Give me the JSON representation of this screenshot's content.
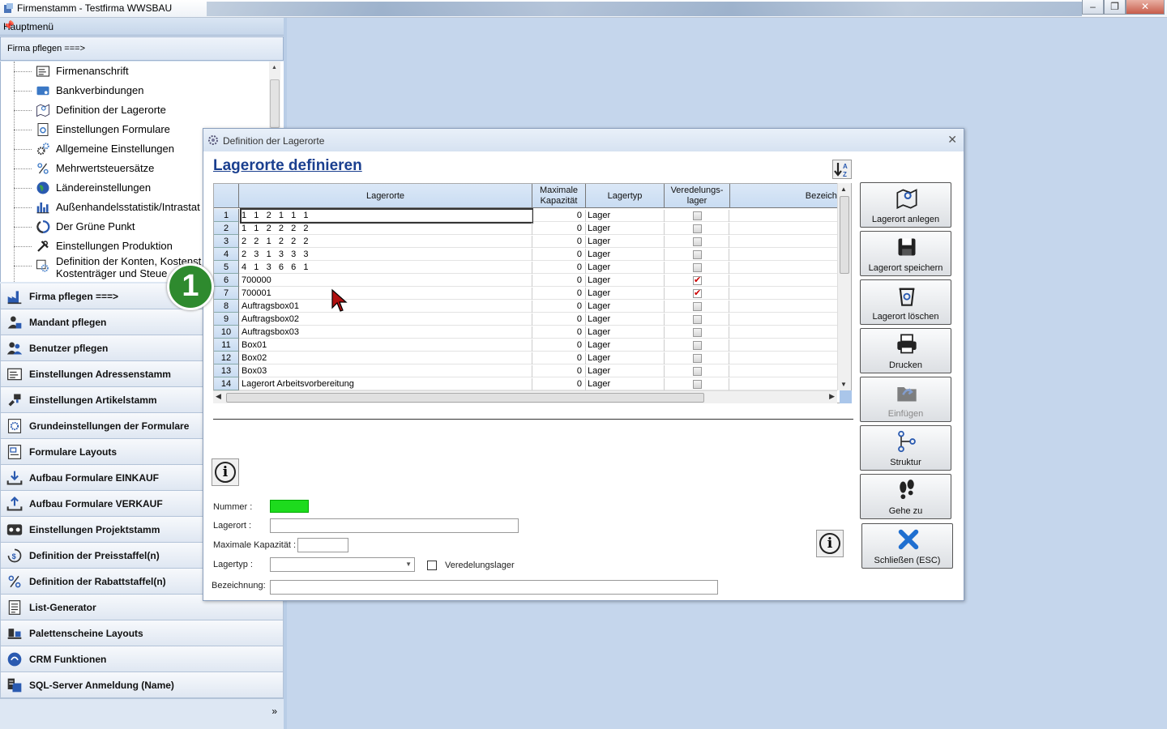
{
  "window": {
    "title": "Firmenstamm - Testfirma WWSBAU"
  },
  "left_panel": {
    "header": "Hauptmenü",
    "current_section": "Firma pflegen   ===>",
    "tree_items": [
      {
        "label": "Firmenanschrift",
        "icon": "address-card-icon"
      },
      {
        "label": "Bankverbindungen",
        "icon": "bank-card-icon"
      },
      {
        "label": "Definition der Lagerorte",
        "icon": "map-pin-icon"
      },
      {
        "label": "Einstellungen Formulare",
        "icon": "form-settings-icon"
      },
      {
        "label": "Allgemeine Einstellungen",
        "icon": "gears-icon"
      },
      {
        "label": "Mehrwertsteuersätze",
        "icon": "percent-icon"
      },
      {
        "label": "Ländereinstellungen",
        "icon": "globe-icon"
      },
      {
        "label": "Außenhandelsstatistik/Intrastat",
        "icon": "bar-chart-icon"
      },
      {
        "label": "Der Grüne Punkt",
        "icon": "recycle-icon"
      },
      {
        "label": "Einstellungen Produktion",
        "icon": "tools-icon"
      },
      {
        "label": "Definition der Konten, Kostenst",
        "label2": "Kostenträger und Steue",
        "icon": "accounts-gear-icon"
      }
    ],
    "nav_items": [
      {
        "label": "Firma pflegen   ===>",
        "icon": "factory-icon"
      },
      {
        "label": "Mandant pflegen",
        "icon": "client-icon"
      },
      {
        "label": "Benutzer pflegen",
        "icon": "users-icon"
      },
      {
        "label": "Einstellungen Adressenstamm",
        "icon": "address-icon"
      },
      {
        "label": "Einstellungen Artikelstamm",
        "icon": "article-icon"
      },
      {
        "label": "Grundeinstellungen der Formulare",
        "icon": "form-gear-icon"
      },
      {
        "label": "Formulare Layouts",
        "icon": "layout-icon"
      },
      {
        "label": "Aufbau Formulare EINKAUF",
        "icon": "download-tray-icon"
      },
      {
        "label": "Aufbau Formulare VERKAUF",
        "icon": "upload-tray-icon"
      },
      {
        "label": "Einstellungen Projektstamm",
        "icon": "project-icon"
      },
      {
        "label": "Definition der Preisstaffel(n)",
        "icon": "price-icon"
      },
      {
        "label": "Definition der Rabattstaffel(n)",
        "icon": "discount-icon"
      },
      {
        "label": "List-Generator",
        "icon": "list-icon"
      },
      {
        "label": "Palettenscheine Layouts",
        "icon": "pallet-icon"
      },
      {
        "label": "CRM Funktionen",
        "icon": "crm-icon"
      },
      {
        "label": "SQL-Server Anmeldung (Name)",
        "icon": "server-icon"
      }
    ],
    "more_glyph": "»"
  },
  "badge": "1",
  "dialog": {
    "title": "Definition der Lagerorte",
    "heading": "Lagerorte definieren",
    "columns": {
      "lagerorte": "Lagerorte",
      "kapazitaet_1": "Maximale",
      "kapazitaet_2": "Kapazität",
      "lagertyp": "Lagertyp",
      "veredelung_1": "Veredelungs-",
      "veredelung_2": "lager",
      "bezeichnung": "Bezeichn"
    },
    "rows": [
      {
        "nr": "1",
        "lagerort": "1   1   2   1   1   1",
        "kap": "0",
        "typ": "Lager",
        "ver": false
      },
      {
        "nr": "2",
        "lagerort": "1   1   2   2   2   2",
        "kap": "0",
        "typ": "Lager",
        "ver": false
      },
      {
        "nr": "3",
        "lagerort": "2   2   1   2   2   2",
        "kap": "0",
        "typ": "Lager",
        "ver": false
      },
      {
        "nr": "4",
        "lagerort": "2   3   1   3   3   3",
        "kap": "0",
        "typ": "Lager",
        "ver": false
      },
      {
        "nr": "5",
        "lagerort": "4   1   3   6   6   1",
        "kap": "0",
        "typ": "Lager",
        "ver": false
      },
      {
        "nr": "6",
        "lagerort": "700000",
        "kap": "0",
        "typ": "Lager",
        "ver": true
      },
      {
        "nr": "7",
        "lagerort": "700001",
        "kap": "0",
        "typ": "Lager",
        "ver": true
      },
      {
        "nr": "8",
        "lagerort": "Auftragsbox01",
        "kap": "0",
        "typ": "Lager",
        "ver": false
      },
      {
        "nr": "9",
        "lagerort": "Auftragsbox02",
        "kap": "0",
        "typ": "Lager",
        "ver": false
      },
      {
        "nr": "10",
        "lagerort": "Auftragsbox03",
        "kap": "0",
        "typ": "Lager",
        "ver": false
      },
      {
        "nr": "11",
        "lagerort": "Box01",
        "kap": "0",
        "typ": "Lager",
        "ver": false
      },
      {
        "nr": "12",
        "lagerort": "Box02",
        "kap": "0",
        "typ": "Lager",
        "ver": false
      },
      {
        "nr": "13",
        "lagerort": "Box03",
        "kap": "0",
        "typ": "Lager",
        "ver": false
      },
      {
        "nr": "14",
        "lagerort": "Lagerort Arbeitsvorbereitung",
        "kap": "0",
        "typ": "Lager",
        "ver": false
      }
    ],
    "form": {
      "nummer_label": "Nummer :",
      "lagerort_label": "Lagerort :",
      "kapazitaet_label": "Maximale Kapazität :",
      "lagertyp_label": "Lagertyp :",
      "veredelung_label": "Veredelungslager",
      "bezeichnung_label": "Bezeichnung:",
      "nummer_value": "",
      "lagerort_value": "",
      "kapazitaet_value": "",
      "lagertyp_value": "",
      "bezeichnung_value": ""
    },
    "buttons": [
      {
        "label": "Lagerort anlegen",
        "icon": "map-add-icon",
        "enabled": true
      },
      {
        "label": "Lagerort speichern",
        "icon": "save-icon",
        "enabled": true
      },
      {
        "label": "Lagerort löschen",
        "icon": "trash-icon",
        "enabled": true
      },
      {
        "label": "Drucken",
        "icon": "printer-icon",
        "enabled": true
      },
      {
        "label": "Einfügen",
        "icon": "paste-folder-icon",
        "enabled": false
      },
      {
        "label": "Struktur",
        "icon": "structure-icon",
        "enabled": true
      },
      {
        "label": "Gehe zu",
        "icon": "footsteps-icon",
        "enabled": true
      },
      {
        "label": "Schließen (ESC)",
        "icon": "close-x-icon",
        "enabled": true
      }
    ]
  },
  "colors": {
    "desktop": "#c5d6ec",
    "heading": "#1a3f8f",
    "nummer_field": "#1ddb1d",
    "badge": "#2e8a2e",
    "checkmark": "#cc0000"
  }
}
